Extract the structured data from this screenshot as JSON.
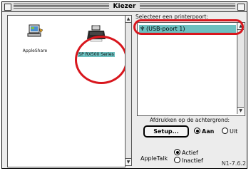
{
  "window": {
    "title": "Kiezer"
  },
  "drivers": [
    {
      "name": "AppleShare",
      "selected": false
    },
    {
      "name": "SP RX500 Series",
      "selected": true
    }
  ],
  "port_panel": {
    "prompt": "Selecteer een printerpoort:",
    "ports": [
      {
        "label": "(USB-poort 1)",
        "selected": true
      }
    ]
  },
  "background_printing": {
    "label": "Afdrukken op de achtergrond:",
    "options": [
      "Aan",
      "Uit"
    ],
    "selected": "Aan"
  },
  "setup_button": "Setup...",
  "appletalk": {
    "label": "AppleTalk",
    "options": [
      "Actief",
      "Inactief"
    ],
    "selected": "Actief"
  },
  "version": "N1-7.6.2",
  "colors": {
    "highlight": "#6cc0c0",
    "annotation_circle": "#d8161d"
  }
}
